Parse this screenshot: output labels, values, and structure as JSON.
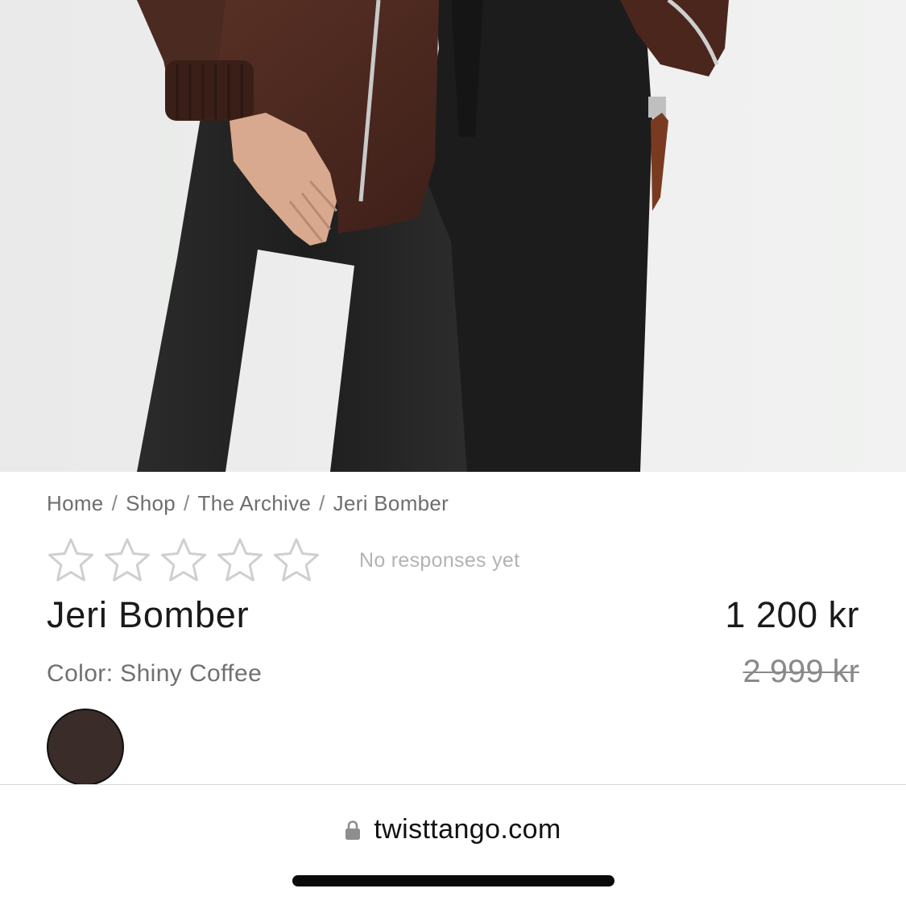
{
  "breadcrumb": [
    "Home",
    "Shop",
    "The Archive",
    "Jeri Bomber"
  ],
  "breadcrumb_separator": "/",
  "rating": {
    "value": 0,
    "max": 5,
    "responses_text": "No responses yet"
  },
  "product": {
    "name": "Jeri Bomber",
    "price": "1 200 kr",
    "original_price": "2 999 kr",
    "color_label": "Color: Shiny Coffee",
    "swatch_color": "#3a2c28"
  },
  "browser": {
    "url": "twisttango.com",
    "icons": [
      "lock-icon"
    ]
  },
  "colors": {
    "text_primary": "#1a1a1a",
    "text_muted": "#6e6e6e",
    "star_outline": "#cfcfcf"
  }
}
